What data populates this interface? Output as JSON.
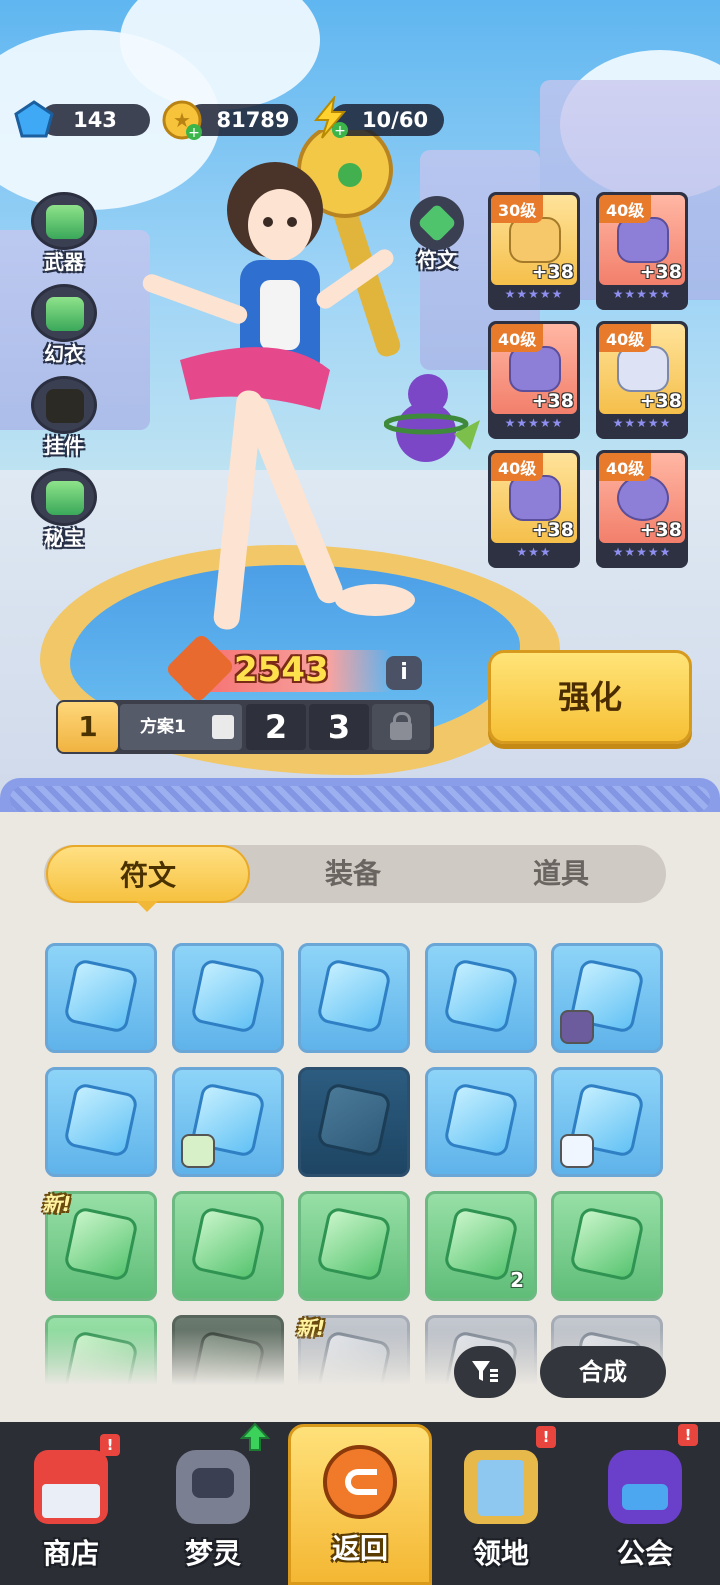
{
  "resources": {
    "gems": "143",
    "gold": "81789",
    "energy": "10/60"
  },
  "side_menu": [
    {
      "label": "武器",
      "icon": "weapon-icon"
    },
    {
      "label": "幻衣",
      "icon": "outfit-icon"
    },
    {
      "label": "挂件",
      "icon": "pendant-icon"
    },
    {
      "label": "秘宝",
      "icon": "treasure-icon"
    }
  ],
  "rune_button": {
    "label": "符文",
    "icon": "rune-icon"
  },
  "equipment": [
    {
      "level": "30级",
      "plus": "+38",
      "stars": "★★★★★"
    },
    {
      "level": "40级",
      "plus": "+38",
      "stars": "★★★★★"
    },
    {
      "level": "40级",
      "plus": "+38",
      "stars": "★★★★★"
    },
    {
      "level": "40级",
      "plus": "+38",
      "stars": "★★★★★"
    },
    {
      "level": "40级",
      "plus": "+38",
      "stars": "★★★"
    },
    {
      "level": "40级",
      "plus": "+38",
      "stars": "★★★★★"
    }
  ],
  "power": {
    "value": "2543",
    "info": "i"
  },
  "plans": {
    "current": "1",
    "name": "方案1",
    "others": [
      "2",
      "3"
    ]
  },
  "enhance_label": "强化",
  "tabs": [
    {
      "label": "符文",
      "active": true
    },
    {
      "label": "装备",
      "active": false
    },
    {
      "label": "道具",
      "active": false
    }
  ],
  "inventory": {
    "new_label": "新!",
    "count_label": "2"
  },
  "actions": {
    "filter": "filter-icon",
    "synthesize": "合成"
  },
  "nav": [
    {
      "label": "商店",
      "alert": "!"
    },
    {
      "label": "梦灵",
      "alert": ""
    },
    {
      "label": "返回",
      "alert": ""
    },
    {
      "label": "领地",
      "alert": "!"
    },
    {
      "label": "公会",
      "alert": "!"
    }
  ],
  "colors": {
    "accent": "#f6c240",
    "panel": "#ebe8e2",
    "nav_bg": "#2c2e36",
    "alert": "#e8453e"
  }
}
